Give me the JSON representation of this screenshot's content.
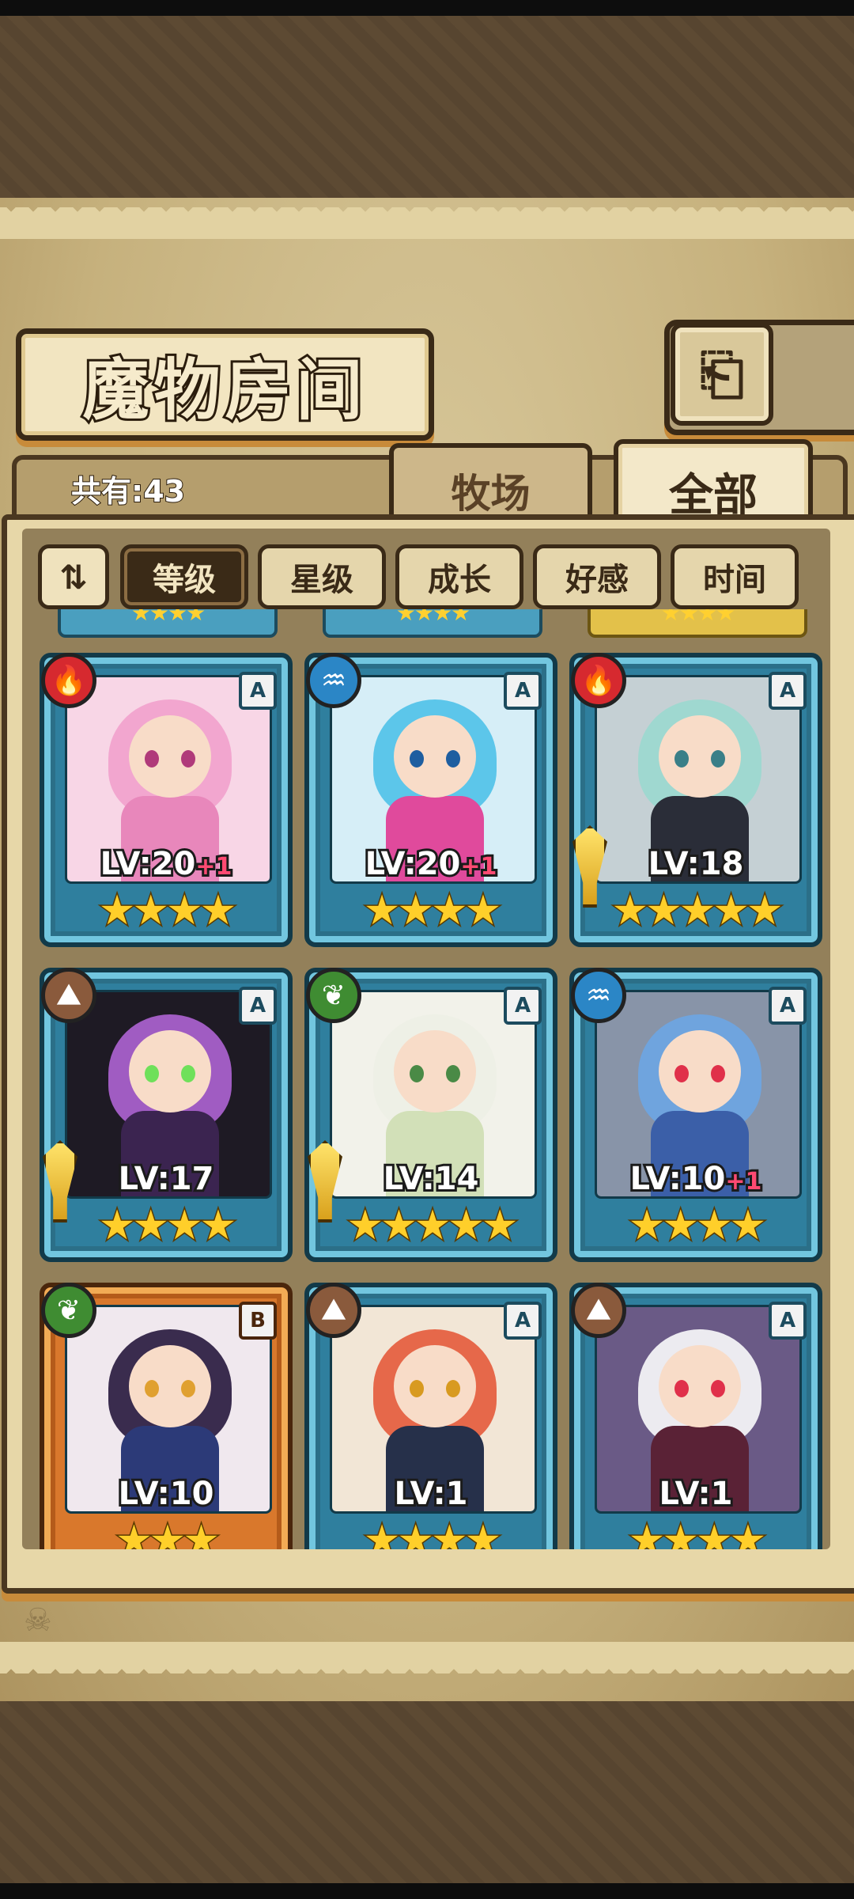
{
  "header": {
    "title": "魔物房间",
    "back_icon": "⎗"
  },
  "tabs": {
    "count_label": "共有:43",
    "ranch": "牧场",
    "all": "全部",
    "active": "全部"
  },
  "sort": {
    "toggle_icon": "⇅",
    "buttons": [
      "等级",
      "星级",
      "成长",
      "好感",
      "时间"
    ],
    "active": "等级"
  },
  "monsters": [
    {
      "element": "fire",
      "element_icon": "🔥",
      "rank": "A",
      "level": "LV:20",
      "bonus": "+1",
      "stars": "★★★★",
      "weapon": false,
      "colors": {
        "hair": "#f2a6cf",
        "body": "#e887bb",
        "bg": "#f8d6e6",
        "eye": "#b03a7a"
      }
    },
    {
      "element": "water",
      "element_icon": "♒",
      "rank": "A",
      "level": "LV:20",
      "bonus": "+1",
      "stars": "★★★★",
      "weapon": false,
      "colors": {
        "hair": "#5cc6ea",
        "body": "#e04a9c",
        "bg": "#d6eef7",
        "eye": "#1e5ea0"
      }
    },
    {
      "element": "fire",
      "element_icon": "🔥",
      "rank": "A",
      "level": "LV:18",
      "bonus": "",
      "stars": "★★★★★",
      "weapon": true,
      "colors": {
        "hair": "#9fd8d0",
        "body": "#2a2d38",
        "bg": "#c5d0d4",
        "eye": "#3a7f88"
      }
    },
    {
      "element": "earth",
      "element_icon": "⛰",
      "rank": "A",
      "level": "LV:17",
      "bonus": "",
      "stars": "★★★★",
      "weapon": true,
      "colors": {
        "hair": "#a05cc2",
        "body": "#3b2450",
        "bg": "#1e1a24",
        "eye": "#6fe05a"
      }
    },
    {
      "element": "leaf",
      "element_icon": "❦",
      "rank": "A",
      "level": "LV:14",
      "bonus": "",
      "stars": "★★★★★",
      "weapon": true,
      "colors": {
        "hair": "#eef0e6",
        "body": "#d2e0b8",
        "bg": "#f2f2ea",
        "eye": "#4a8a46"
      }
    },
    {
      "element": "water",
      "element_icon": "♒",
      "rank": "A",
      "level": "LV:10",
      "bonus": "+1",
      "stars": "★★★★",
      "weapon": false,
      "colors": {
        "hair": "#6fa4de",
        "body": "#3b5fa8",
        "bg": "#8894a8",
        "eye": "#e0304a"
      }
    },
    {
      "element": "leaf",
      "element_icon": "❦",
      "rank": "B",
      "level": "LV:10",
      "bonus": "",
      "stars": "★★★",
      "weapon": false,
      "colors": {
        "hair": "#3a2c4e",
        "body": "#2c3a78",
        "bg": "#f0e8ee",
        "eye": "#e0a030"
      }
    },
    {
      "element": "earth",
      "element_icon": "⛰",
      "rank": "A",
      "level": "LV:1",
      "bonus": "",
      "stars": "★★★★",
      "weapon": false,
      "colors": {
        "hair": "#e6684a",
        "body": "#26304a",
        "bg": "#f2e6d6",
        "eye": "#d89a20"
      }
    },
    {
      "element": "earth",
      "element_icon": "⛰",
      "rank": "A",
      "level": "LV:1",
      "bonus": "",
      "stars": "★★★★",
      "weapon": false,
      "colors": {
        "hair": "#ecebf0",
        "body": "#5a2236",
        "bg": "#6a5a86",
        "eye": "#e0304a"
      }
    }
  ],
  "partial_row": [
    {
      "stars": "★★★★",
      "gold": false
    },
    {
      "stars": "★★★★",
      "gold": false
    },
    {
      "stars": "★★★★",
      "gold": true
    }
  ]
}
